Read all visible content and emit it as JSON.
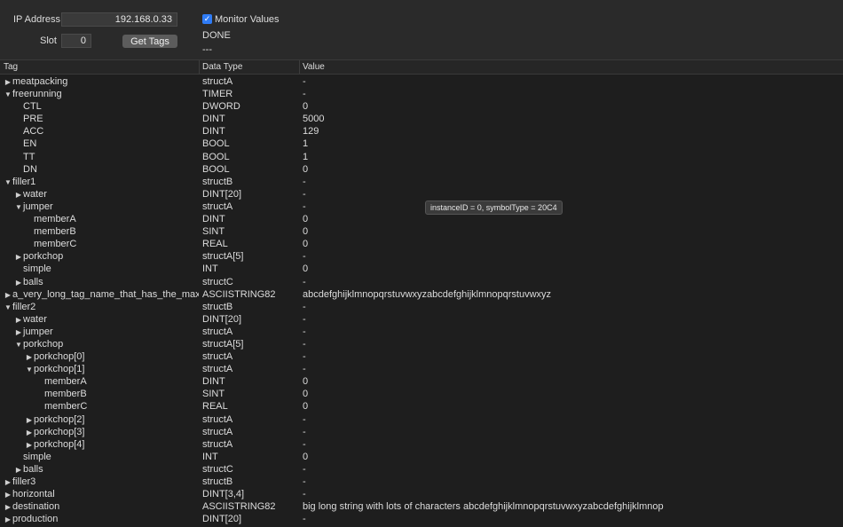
{
  "toolbar": {
    "ip_label": "IP Address",
    "ip_value": "192.168.0.33",
    "slot_label": "Slot",
    "slot_value": "0",
    "get_tags_label": "Get Tags",
    "monitor_label": "Monitor Values",
    "monitor_checked": true,
    "status_text": "DONE",
    "status_sub": "---"
  },
  "table": {
    "columns": [
      "Tag",
      "Data Type",
      "Value"
    ],
    "rows": [
      {
        "depth": 0,
        "expander": "collapsed",
        "tag": "meatpacking",
        "type": "structA",
        "value": "-"
      },
      {
        "depth": 0,
        "expander": "expanded",
        "tag": "freerunning",
        "type": "TIMER",
        "value": "-"
      },
      {
        "depth": 1,
        "expander": "none",
        "tag": "CTL",
        "type": "DWORD",
        "value": "0"
      },
      {
        "depth": 1,
        "expander": "none",
        "tag": "PRE",
        "type": "DINT",
        "value": "5000"
      },
      {
        "depth": 1,
        "expander": "none",
        "tag": "ACC",
        "type": "DINT",
        "value": "129"
      },
      {
        "depth": 1,
        "expander": "none",
        "tag": "EN",
        "type": "BOOL",
        "value": "1"
      },
      {
        "depth": 1,
        "expander": "none",
        "tag": "TT",
        "type": "BOOL",
        "value": "1"
      },
      {
        "depth": 1,
        "expander": "none",
        "tag": "DN",
        "type": "BOOL",
        "value": "0"
      },
      {
        "depth": 0,
        "expander": "expanded",
        "tag": "filler1",
        "type": "structB",
        "value": "-"
      },
      {
        "depth": 1,
        "expander": "collapsed",
        "tag": "water",
        "type": "DINT[20]",
        "value": "-"
      },
      {
        "depth": 1,
        "expander": "expanded",
        "tag": "jumper",
        "type": "structA",
        "value": "-"
      },
      {
        "depth": 2,
        "expander": "none",
        "tag": "memberA",
        "type": "DINT",
        "value": "0"
      },
      {
        "depth": 2,
        "expander": "none",
        "tag": "memberB",
        "type": "SINT",
        "value": "0"
      },
      {
        "depth": 2,
        "expander": "none",
        "tag": "memberC",
        "type": "REAL",
        "value": "0"
      },
      {
        "depth": 1,
        "expander": "collapsed",
        "tag": "porkchop",
        "type": "structA[5]",
        "value": "-"
      },
      {
        "depth": 1,
        "expander": "none",
        "tag": "simple",
        "type": "INT",
        "value": "0"
      },
      {
        "depth": 1,
        "expander": "collapsed",
        "tag": "balls",
        "type": "structC",
        "value": "-"
      },
      {
        "depth": 0,
        "expander": "collapsed",
        "tag": "a_very_long_tag_name_that_has_the_max_nu",
        "type": "ASCIISTRING82",
        "value": "abcdefghijklmnopqrstuvwxyzabcdefghijklmnopqrstuvwxyz"
      },
      {
        "depth": 0,
        "expander": "expanded",
        "tag": "filler2",
        "type": "structB",
        "value": "-"
      },
      {
        "depth": 1,
        "expander": "collapsed",
        "tag": "water",
        "type": "DINT[20]",
        "value": "-"
      },
      {
        "depth": 1,
        "expander": "collapsed",
        "tag": "jumper",
        "type": "structA",
        "value": "-"
      },
      {
        "depth": 1,
        "expander": "expanded",
        "tag": "porkchop",
        "type": "structA[5]",
        "value": "-"
      },
      {
        "depth": 2,
        "expander": "collapsed",
        "tag": "porkchop[0]",
        "type": "structA",
        "value": "-"
      },
      {
        "depth": 2,
        "expander": "expanded",
        "tag": "porkchop[1]",
        "type": "structA",
        "value": "-"
      },
      {
        "depth": 3,
        "expander": "none",
        "tag": "memberA",
        "type": "DINT",
        "value": "0"
      },
      {
        "depth": 3,
        "expander": "none",
        "tag": "memberB",
        "type": "SINT",
        "value": "0"
      },
      {
        "depth": 3,
        "expander": "none",
        "tag": "memberC",
        "type": "REAL",
        "value": "0"
      },
      {
        "depth": 2,
        "expander": "collapsed",
        "tag": "porkchop[2]",
        "type": "structA",
        "value": "-"
      },
      {
        "depth": 2,
        "expander": "collapsed",
        "tag": "porkchop[3]",
        "type": "structA",
        "value": "-"
      },
      {
        "depth": 2,
        "expander": "collapsed",
        "tag": "porkchop[4]",
        "type": "structA",
        "value": "-"
      },
      {
        "depth": 1,
        "expander": "none",
        "tag": "simple",
        "type": "INT",
        "value": "0"
      },
      {
        "depth": 1,
        "expander": "collapsed",
        "tag": "balls",
        "type": "structC",
        "value": "-"
      },
      {
        "depth": 0,
        "expander": "collapsed",
        "tag": "filler3",
        "type": "structB",
        "value": "-"
      },
      {
        "depth": 0,
        "expander": "collapsed",
        "tag": "horizontal",
        "type": "DINT[3,4]",
        "value": "-"
      },
      {
        "depth": 0,
        "expander": "collapsed",
        "tag": "destination",
        "type": "ASCIISTRING82",
        "value": "big long string with lots of characters abcdefghijklmnopqrstuvwxyzabcdefghijklmnop"
      },
      {
        "depth": 0,
        "expander": "collapsed",
        "tag": "production",
        "type": "DINT[20]",
        "value": "-"
      }
    ]
  },
  "tooltip": {
    "text": "instanceID = 0, symbolType = 20C4"
  },
  "colors": {
    "background": "#1e1e1e",
    "toolbar": "#2a2a2a",
    "checkbox": "#2f7cf6",
    "button": "#5c5c5c"
  }
}
